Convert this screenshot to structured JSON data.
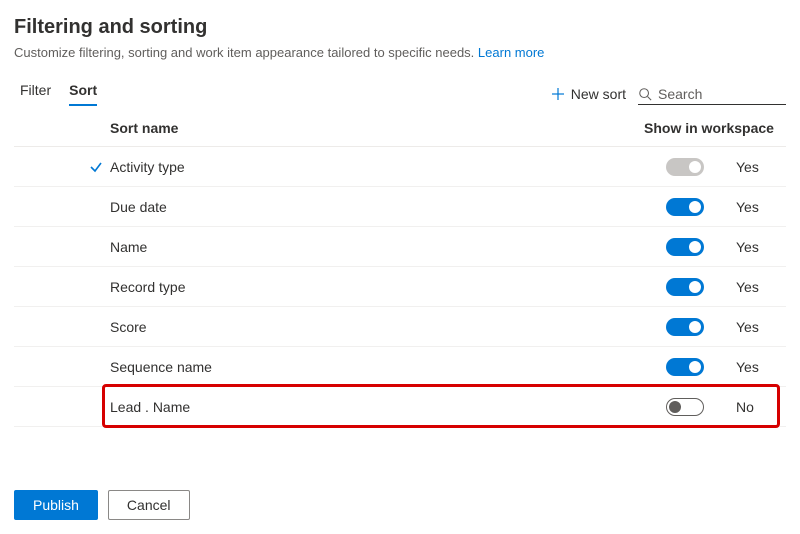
{
  "header": {
    "title": "Filtering and sorting",
    "subtitle": "Customize filtering, sorting and work item appearance tailored to specific needs.",
    "learn_more": "Learn more"
  },
  "tabs": {
    "filter": "Filter",
    "sort": "Sort"
  },
  "toolbar": {
    "new_sort": "New sort",
    "search_placeholder": "Search"
  },
  "columns": {
    "name": "Sort name",
    "show": "Show in workspace"
  },
  "rows": [
    {
      "name": "Activity type",
      "checked": true,
      "on": true,
      "disabled": true,
      "label": "Yes"
    },
    {
      "name": "Due date",
      "checked": false,
      "on": true,
      "disabled": false,
      "label": "Yes"
    },
    {
      "name": "Name",
      "checked": false,
      "on": true,
      "disabled": false,
      "label": "Yes"
    },
    {
      "name": "Record type",
      "checked": false,
      "on": true,
      "disabled": false,
      "label": "Yes"
    },
    {
      "name": "Score",
      "checked": false,
      "on": true,
      "disabled": false,
      "label": "Yes"
    },
    {
      "name": "Sequence name",
      "checked": false,
      "on": true,
      "disabled": false,
      "label": "Yes"
    },
    {
      "name": "Lead . Name",
      "checked": false,
      "on": false,
      "disabled": false,
      "label": "No"
    }
  ],
  "buttons": {
    "publish": "Publish",
    "cancel": "Cancel"
  },
  "highlight_row_index": 6
}
